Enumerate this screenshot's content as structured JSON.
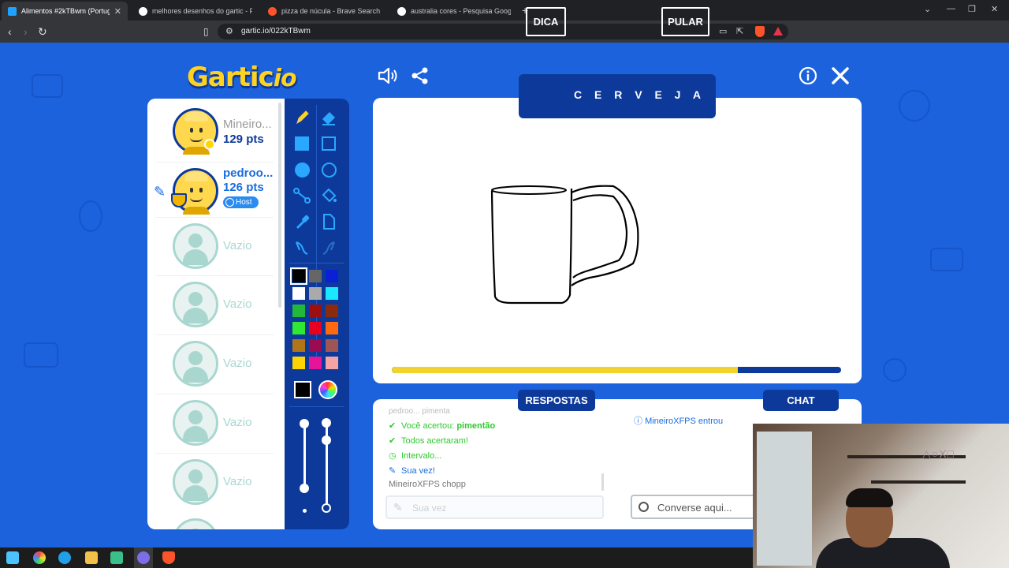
{
  "browser": {
    "tabs": [
      {
        "title": "Alimentos #2kTBwm (Portuguê...",
        "active": true,
        "favicon_color": "#1fa2ff"
      },
      {
        "title": "melhores desenhos do gartic - Pesqu...",
        "active": false,
        "favicon_color": "#ffffff"
      },
      {
        "title": "pizza de núcula - Brave Search",
        "active": false,
        "favicon_color": "#fb542b"
      },
      {
        "title": "australia cores - Pesquisa Google",
        "active": false,
        "favicon_color": "#ffffff"
      }
    ],
    "url": "gartic.io/022kTBwm"
  },
  "game": {
    "logo": "Gartic",
    "logo_suffix": "io",
    "word": {
      "hint_label": "DICA",
      "text": "C E R V E J A",
      "skip_label": "PULAR"
    },
    "players": [
      {
        "name": "Mineiro...",
        "points": "129 pts",
        "avatar": "smiling-avatar",
        "online": true
      },
      {
        "name": "pedroo...",
        "points": "126 pts",
        "badge": "Host",
        "drawing": true,
        "avatar": "smiling-avatar"
      },
      {
        "name": "Vazio"
      },
      {
        "name": "Vazio"
      },
      {
        "name": "Vazio"
      },
      {
        "name": "Vazio"
      },
      {
        "name": "Vazio"
      }
    ],
    "palette": [
      "#000000",
      "#666666",
      "#0a1fd6",
      "#ffffff",
      "#aaaaaa",
      "#19e8ff",
      "#22b83a",
      "#9b0f0f",
      "#8a2b0e",
      "#2ee833",
      "#e8001f",
      "#ff6a10",
      "#b07516",
      "#9a0b52",
      "#a05555",
      "#ffd400",
      "#e6149a",
      "#f6a3a6"
    ],
    "selected_color": "#000000",
    "timer_progress": 0.77,
    "answers_tab": "RESPOSTAS",
    "chat_tab": "CHAT",
    "answers": [
      {
        "text": "Você acertou: ",
        "highlight": "pimentão",
        "style": "green"
      },
      {
        "text": "Todos acertaram!",
        "style": "green"
      },
      {
        "text": "Intervalo...",
        "style": "green"
      },
      {
        "text": "Sua vez!",
        "style": "blue"
      },
      {
        "text": "MineiroXFPS chopp",
        "style": "grey"
      }
    ],
    "answer_placeholder": "Sua vez",
    "chat_messages": [
      {
        "text": "MineiroXFPS entrou"
      }
    ],
    "chat_placeholder": "Converse aqui..."
  },
  "webcam": {
    "overlay_text": "△○X□"
  },
  "colors": {
    "accent_dark": "#0d3a9a",
    "accent_yellow": "#ffd21f",
    "correct_green": "#2ec92e"
  }
}
